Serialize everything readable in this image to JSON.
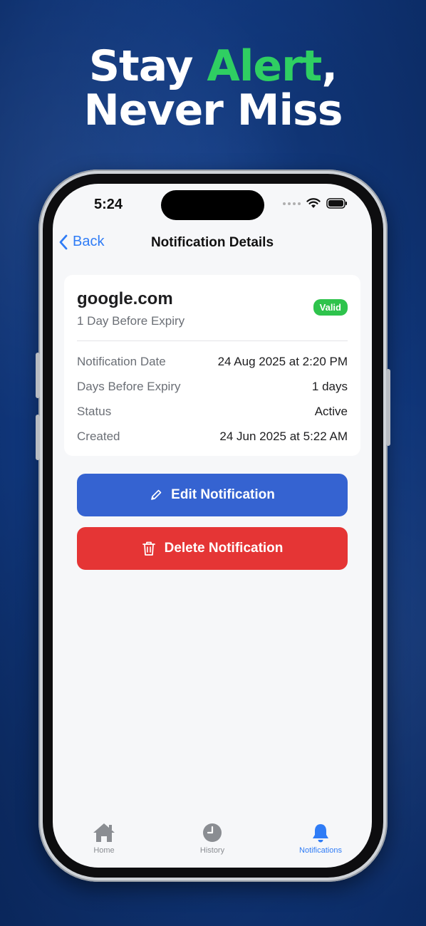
{
  "headline": {
    "line1_pre": "Stay ",
    "line1_accent": "Alert",
    "line1_post": ",",
    "line2": "Never Miss"
  },
  "status_bar": {
    "time": "5:24"
  },
  "navbar": {
    "back_label": "Back",
    "title": "Notification Details"
  },
  "notification": {
    "domain": "google.com",
    "subtitle": "1 Day Before Expiry",
    "badge": "Valid",
    "details": [
      {
        "label": "Notification Date",
        "value": "24 Aug 2025 at 2:20 PM"
      },
      {
        "label": "Days Before Expiry",
        "value": "1 days"
      },
      {
        "label": "Status",
        "value": "Active"
      },
      {
        "label": "Created",
        "value": "24 Jun 2025 at 5:22 AM"
      }
    ]
  },
  "actions": {
    "edit_label": "Edit Notification",
    "delete_label": "Delete Notification"
  },
  "tabbar": {
    "home": "Home",
    "history": "History",
    "notifications": "Notifications"
  },
  "colors": {
    "accent_green": "#2fcf62",
    "primary_blue": "#3563d1",
    "danger_red": "#e53535",
    "badge_green": "#2ec34c",
    "link_blue": "#2f7cf6"
  },
  "icons": [
    "chevron-left-icon",
    "wifi-icon",
    "battery-icon",
    "pencil-icon",
    "trash-icon",
    "home-icon",
    "clock-icon",
    "bell-icon"
  ]
}
